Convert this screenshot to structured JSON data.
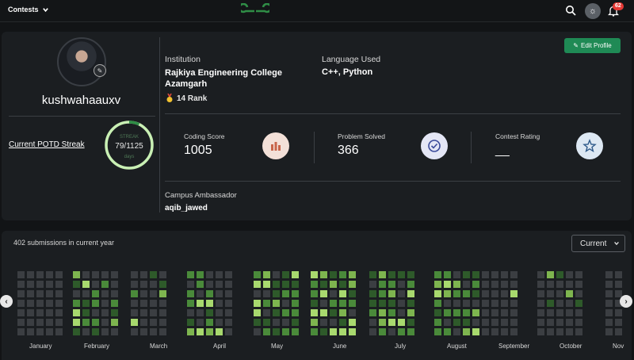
{
  "header": {
    "contests_label": "Contests",
    "notification_count": "62",
    "icons": [
      "search-icon",
      "theme-toggle-icon",
      "bell-icon"
    ]
  },
  "profile": {
    "username": "kushwahaauxv",
    "potd_label": "Current POTD Streak",
    "streak_label": "STREAK",
    "streak_value": "79/1125",
    "streak_unit": "days",
    "streak_fraction": 0.0702,
    "edit_label": "Edit Profile",
    "institution_label": "Institution",
    "institution_value": "Rajkiya Engineering College Azamgarh",
    "rank_value": "14 Rank",
    "language_label": "Language Used",
    "language_value": "C++, Python",
    "ambassador_label": "Campus Ambassador",
    "ambassador_value": "aqib_jawed"
  },
  "stats": [
    {
      "label": "Coding Score",
      "value": "1005",
      "icon": "bar-chart-icon",
      "color": "#c8654a"
    },
    {
      "label": "Problem Solved",
      "value": "366",
      "icon": "check-circle-icon",
      "color": "#3b4a9a"
    },
    {
      "label": "Contest Rating",
      "value": "__",
      "icon": "star-icon",
      "color": "#2f5a8a"
    }
  ],
  "submissions": {
    "summary": "402 submissions in current year",
    "period_selected": "Current",
    "months": [
      "January",
      "February",
      "March",
      "April",
      "May",
      "June",
      "July",
      "August",
      "September",
      "October",
      "Nov"
    ]
  },
  "colors": {
    "accent": "#2f8d46",
    "cell_empty": "#3b3e42",
    "cell_levels": [
      "#2e5a2a",
      "#4a8a3a",
      "#7eb54f",
      "#a8d96e"
    ]
  }
}
